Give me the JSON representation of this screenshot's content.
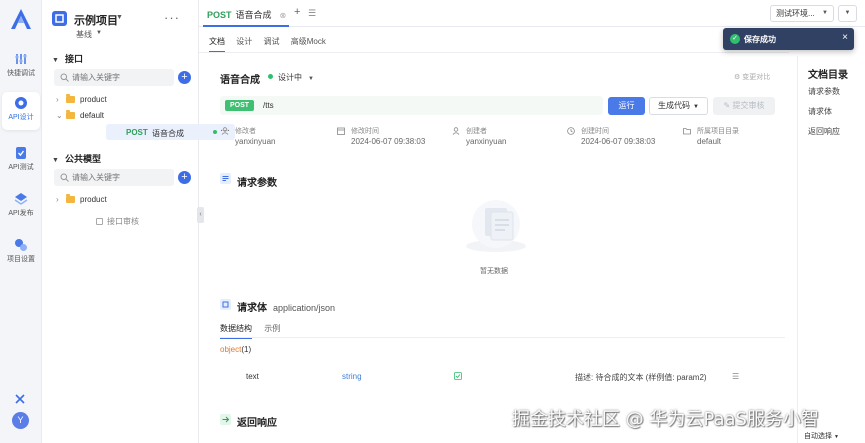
{
  "rail": {
    "items": [
      {
        "label": "快捷调试",
        "icon": "debug-icon"
      },
      {
        "label": "API设计",
        "icon": "api-design-icon"
      },
      {
        "label": "API测试",
        "icon": "api-test-icon"
      },
      {
        "label": "API发布",
        "icon": "api-publish-icon"
      },
      {
        "label": "项目设置",
        "icon": "project-settings-icon"
      }
    ],
    "avatar": "Y",
    "accent_color": "#2f6fdc"
  },
  "project": {
    "title": "示例项目",
    "branch": "基线"
  },
  "tree": {
    "section_interfaces": "接口",
    "search_placeholder": "请输入关键字",
    "folders": [
      {
        "name": "product"
      },
      {
        "name": "default"
      }
    ],
    "selected_api": {
      "method": "POST",
      "name": "语音合成"
    },
    "section_models": "公共模型",
    "model_search_placeholder": "请输入关键字",
    "model_folders": [
      {
        "name": "product"
      }
    ],
    "audit_label": "接口审核"
  },
  "tabbar": {
    "active_tab": {
      "method": "POST",
      "name": "语音合成"
    },
    "environment": "测试环境..."
  },
  "subtabs": [
    "文档",
    "设计",
    "调试",
    "高级Mock"
  ],
  "api": {
    "title": "语音合成",
    "status": "设计中",
    "changes_label": "变更对比",
    "method": "POST",
    "path": "/tts",
    "run_label": "运行",
    "gen_code_label": "生成代码",
    "submit_review_label": "提交审核"
  },
  "meta": [
    {
      "key": "修改者",
      "value": "yanxinyuan",
      "icon": "user-icon"
    },
    {
      "key": "修改时间",
      "value": "2024-06-07 09:38:03",
      "icon": "calendar-icon"
    },
    {
      "key": "创建者",
      "value": "yanxinyuan",
      "icon": "user-icon"
    },
    {
      "key": "创建时间",
      "value": "2024-06-07 09:38:03",
      "icon": "clock-icon"
    },
    {
      "key": "所属项目目录",
      "value": "default",
      "icon": "folder-icon"
    }
  ],
  "request_params": {
    "title": "请求参数",
    "empty_text": "暂无数据"
  },
  "request_body": {
    "title": "请求体",
    "content_type": "application/json",
    "tabs": [
      "数据结构",
      "示例"
    ],
    "root_type": "object",
    "root_count": "(1)",
    "fields": [
      {
        "name": "text",
        "type": "string",
        "description": "描述: 待合成的文本 (样例值: param2)"
      }
    ]
  },
  "response": {
    "title": "返回响应"
  },
  "toc": {
    "title": "文档目录",
    "items": [
      "请求参数",
      "请求体",
      "返回响应"
    ]
  },
  "toast": {
    "message": "保存成功"
  },
  "footer": {
    "autosave": "自动选择"
  },
  "watermark": "掘金技术社区 @ 华为云PaaS服务小智"
}
